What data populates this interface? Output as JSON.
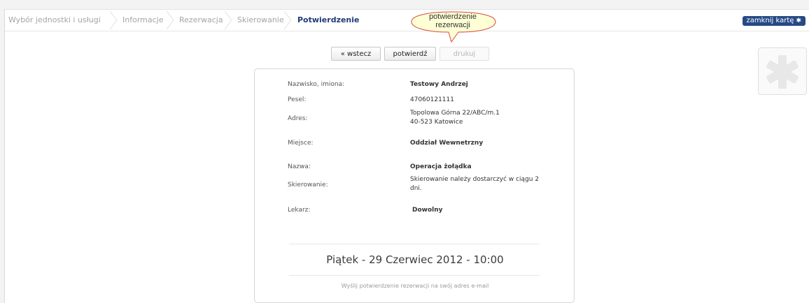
{
  "breadcrumb": {
    "steps": [
      "Wybór jednostki i usługi",
      "Informacje",
      "Rezerwacja",
      "Skierowanie",
      "Potwierdzenie"
    ]
  },
  "tooltip": {
    "line1": "potwierdzenie",
    "line2": "rezerwacji"
  },
  "header": {
    "close_label": "zamknij kartę",
    "close_icon": "close-x-icon"
  },
  "toolbar": {
    "back_label": "« wstecz",
    "confirm_label": "potwierdź",
    "print_label": "drukuj"
  },
  "details": {
    "name_label": "Nazwisko, imiona:",
    "name_value": "Testowy Andrzej",
    "pesel_label": "Pesel:",
    "pesel_value": "47060121111",
    "address_label": "Adres:",
    "address_line1": "Topolowa Górna 22/ABC/m.1",
    "address_line2": "40-523 Katowice",
    "place_label": "Miejsce:",
    "place_value": "Oddział Wewnetrzny",
    "service_label": "Nazwa:",
    "service_value": "Operacja żołądka",
    "referral_label": "Skierowanie:",
    "referral_line1": "Skierowanie należy dostarczyć w ciągu 2",
    "referral_line2": "dni.",
    "doctor_label": "Lekarz:",
    "doctor_value": "Dowolny"
  },
  "appointment": {
    "datetime": "Piątek - 29 Czerwiec 2012 - 10:00"
  },
  "email_link": "Wyślij potwierdzenie rezerwacji na swój adres e-mail",
  "colors": {
    "accent": "#274a86",
    "active_crumb": "#1f3b74",
    "bubble_fill": "#ffffd6",
    "bubble_border": "#d84a3a"
  },
  "icons": {
    "logo": "star-of-life-icon"
  }
}
